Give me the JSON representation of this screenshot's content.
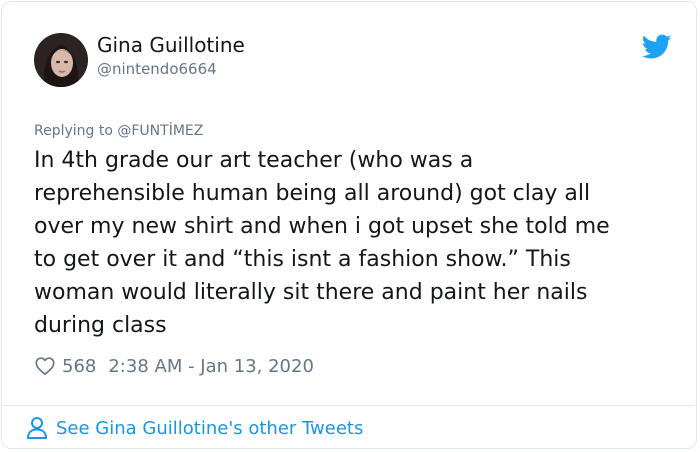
{
  "author": {
    "display_name": "Gina Guillotine",
    "handle": "@nintendo6664"
  },
  "reply_context": "Replying to @FUNTİMEZ",
  "tweet": {
    "lines": [
      "In 4th grade our art teacher (who was a",
      "reprehensible human being all around) got clay all",
      "over my new shirt and when i got upset she told me",
      "to get over it and “this isnt a fashion show.” This",
      "woman would literally sit there and paint her nails",
      "during class"
    ],
    "like_count": "568",
    "timestamp": "2:38 AM - Jan 13, 2020"
  },
  "footer": {
    "link_label": "See Gina Guillotine's other Tweets"
  },
  "icons": {
    "brand": "twitter-bird-icon",
    "like": "heart-icon",
    "footer": "person-icon"
  },
  "colors": {
    "twitter_blue": "#1da1f2",
    "link_blue": "#1b95e0",
    "secondary_text": "#657786",
    "primary_text": "#14171a",
    "border": "#e1e8ed"
  }
}
